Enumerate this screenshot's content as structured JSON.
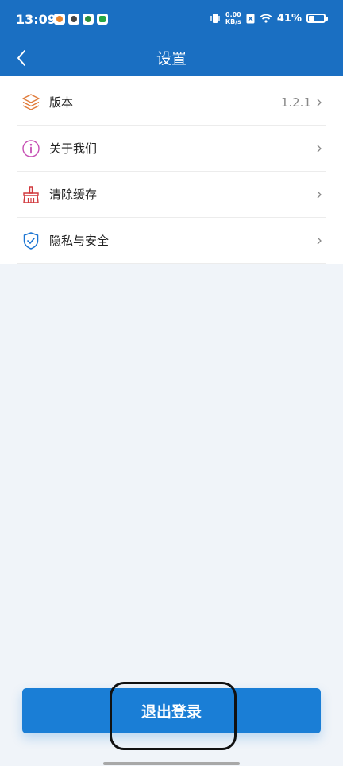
{
  "status_bar": {
    "time": "13:09",
    "net_speed_value": "0.00",
    "net_speed_unit": "KB/s",
    "battery_percent": "41%",
    "battery_level": 0.41,
    "icons": [
      "weibo-icon",
      "app-icon",
      "app-icon",
      "app-icon",
      "vibrate-icon",
      "sim-off-icon",
      "wifi-icon",
      "battery-icon"
    ]
  },
  "header": {
    "title": "设置",
    "back_icon": "chevron-left-icon"
  },
  "settings": {
    "items": [
      {
        "label": "版本",
        "value": "1.2.1",
        "icon": "layers-icon",
        "color": "#e07b39"
      },
      {
        "label": "关于我们",
        "icon": "info-icon",
        "color": "#c64fb4"
      },
      {
        "label": "清除缓存",
        "icon": "broom-icon",
        "color": "#d1383d"
      },
      {
        "label": "隐私与安全",
        "icon": "shield-check-icon",
        "color": "#1a74d2"
      }
    ]
  },
  "logout": {
    "label": "退出登录"
  },
  "colors": {
    "primary": "#1a6fc2",
    "button": "#1a7ed6",
    "background": "#f0f4f9"
  }
}
